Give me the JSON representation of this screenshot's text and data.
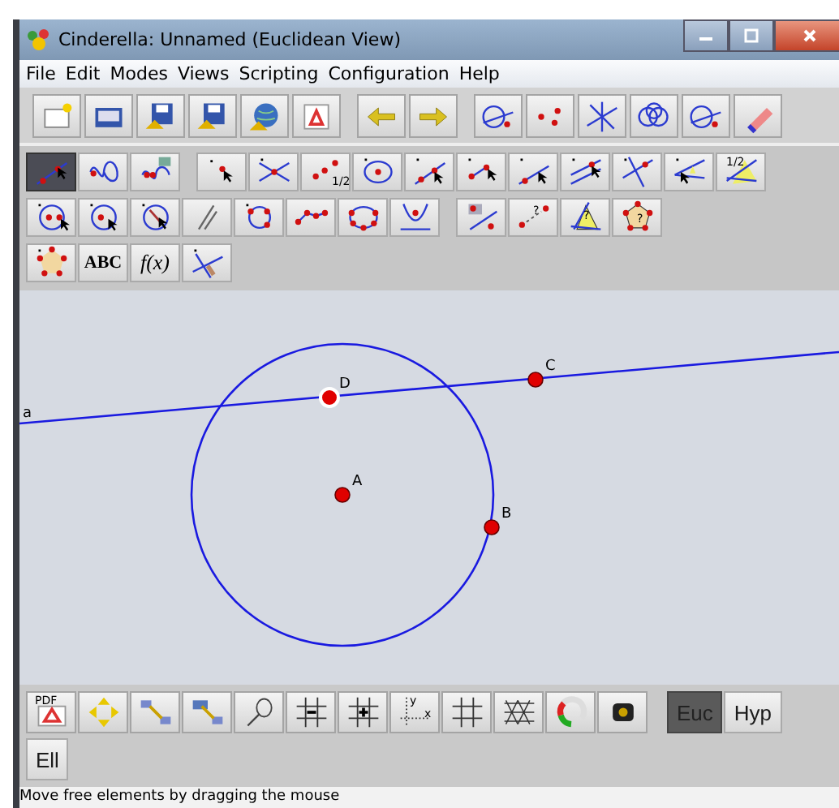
{
  "window": {
    "title": "Cinderella: Unnamed (Euclidean View)"
  },
  "menu": [
    "File",
    "Edit",
    "Modes",
    "Views",
    "Scripting",
    "Configuration",
    "Help"
  ],
  "mode_toolbar": [
    [
      {
        "selected": true
      },
      {
        "selected": false
      },
      {
        "selected": false
      },
      {
        "selected": false
      },
      {
        "selected": false
      },
      {
        "selected": false,
        "caption": "1/2"
      },
      {
        "selected": false
      },
      {
        "selected": false
      },
      {
        "selected": false
      },
      {
        "selected": false
      },
      {
        "selected": false
      },
      {
        "selected": false
      },
      {
        "selected": false
      },
      {
        "selected": false,
        "caption": "1/2"
      }
    ],
    [
      {
        "selected": false
      },
      {
        "selected": false
      },
      {
        "selected": false
      },
      {
        "selected": false
      },
      {
        "selected": false
      },
      {
        "selected": false
      },
      {
        "selected": false
      },
      {
        "selected": false
      },
      {
        "selected": false
      },
      {
        "selected": false,
        "caption": "?"
      },
      {
        "selected": false,
        "caption": "?"
      },
      {
        "selected": false,
        "caption": "?"
      }
    ],
    [
      {
        "selected": false
      },
      {
        "selected": false,
        "label": "ABC"
      },
      {
        "selected": false,
        "label": "f(x)"
      },
      {
        "selected": false
      }
    ]
  ],
  "canvas": {
    "line": {
      "label": "a"
    },
    "points": [
      {
        "label": "A",
        "highlighted": false
      },
      {
        "label": "B",
        "highlighted": false
      },
      {
        "label": "C",
        "highlighted": false
      },
      {
        "label": "D",
        "highlighted": true
      }
    ]
  },
  "view_toolbar": {
    "pdf_caption": "PDF",
    "axis_labels": [
      "y",
      "x"
    ],
    "geometries": [
      {
        "label": "Euc",
        "selected": true
      },
      {
        "label": "Hyp",
        "selected": false
      },
      {
        "label": "Ell",
        "selected": false
      }
    ]
  },
  "status_bar": "Move free elements by dragging the mouse"
}
